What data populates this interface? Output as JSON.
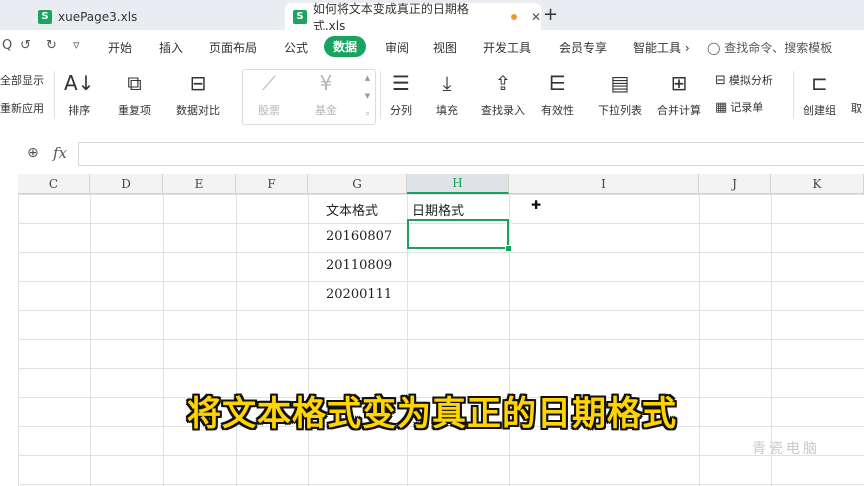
{
  "tabs": [
    {
      "label": "xuePage3.xls",
      "icon": "S"
    },
    {
      "label": "如何将文本变成真正的日期格式.xls",
      "icon": "S"
    }
  ],
  "tab_new_symbol": "+",
  "tab_close_symbol": "✕",
  "quick_access": [
    "↺",
    "↻",
    "▿"
  ],
  "menu": [
    "开始",
    "插入",
    "页面布局",
    "公式",
    "数据",
    "审阅",
    "视图",
    "开发工具",
    "会员专享",
    "智能工具 ›"
  ],
  "active_menu": "数据",
  "search_command": "◯ 查找命令、搜索模板",
  "ribbon": {
    "left_partial": [
      "全部显示",
      "重新应用"
    ],
    "sort": "排序",
    "duplicates": "重复项",
    "compare": "数据对比",
    "stocks": "股票",
    "funds": "基金",
    "split": "分列",
    "fill": "填充",
    "lookup": "查找录入",
    "validation": "有效性",
    "dropdown": "下拉列表",
    "consolidate": "合并计算",
    "simulation": "模拟分析",
    "record": "记录单",
    "group": "创建组",
    "right_partial": "取"
  },
  "formula_bar": {
    "fx": "fx",
    "value": ""
  },
  "columns": [
    "C",
    "D",
    "E",
    "F",
    "G",
    "H",
    "I",
    "J",
    "K"
  ],
  "selected_column": "H",
  "cells": {
    "G1": "文本格式",
    "H1": "日期格式",
    "G2": "20160807",
    "G3": "20110809",
    "G4": "20200111"
  },
  "caption": "将文本格式变为真正的日期格式",
  "watermark": "青瓷电脑",
  "colors": {
    "accent": "#1aa260",
    "caption": "#ffd400"
  }
}
